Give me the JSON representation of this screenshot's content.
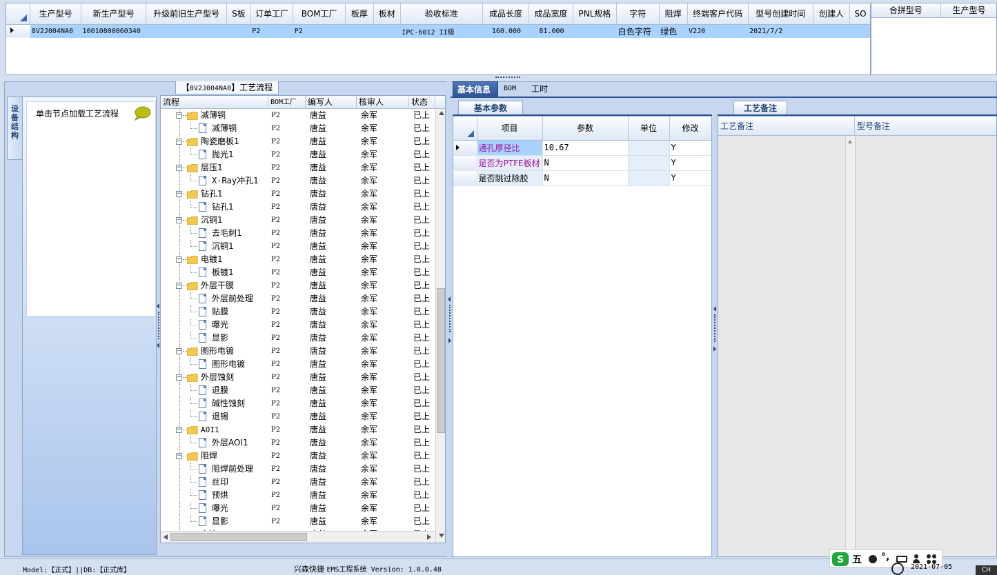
{
  "top_grid": {
    "columns": [
      "生产型号",
      "新生产型号",
      "升级前旧生产型号",
      "S板",
      "订单工厂",
      "BOM工厂",
      "板厚",
      "板材",
      "验收标准",
      "成品长度",
      "成品宽度",
      "PNL规格",
      "字符",
      "阻焊",
      "终端客户代码",
      "型号创建时间",
      "创建人",
      "SO"
    ],
    "rows": [
      [
        "8V2J004NA0",
        "10010800060340",
        "",
        "",
        "P2",
        "P2",
        "",
        "",
        "IPC-6012 II级",
        "160.000",
        "81.000",
        "",
        "白色字符",
        "绿色",
        "V2J0",
        "2021/7/2",
        "",
        ""
      ]
    ]
  },
  "merge_grid": {
    "columns": [
      "合拼型号",
      "生产型号"
    ]
  },
  "left": {
    "vertical_tab": "设备结构",
    "equip_hint": "单击节点加载工艺流程",
    "process_title_prefix": "【",
    "process_title_code": "8V2J004NA0",
    "process_title_suffix": "】工艺流程"
  },
  "tree": {
    "columns": [
      "流程",
      "BOM工厂",
      "编写人",
      "核审人",
      "状态"
    ],
    "rows": [
      {
        "level": 0,
        "label": "减薄铜",
        "bom": "P2",
        "writer": "唐益",
        "reviewer": "余军",
        "status": "已上网"
      },
      {
        "level": 1,
        "label": "减薄铜",
        "bom": "P2",
        "writer": "唐益",
        "reviewer": "余军",
        "status": "已上网"
      },
      {
        "level": 0,
        "label": "陶瓷磨板1",
        "bom": "P2",
        "writer": "唐益",
        "reviewer": "余军",
        "status": "已上网"
      },
      {
        "level": 1,
        "label": "抛光1",
        "bom": "P2",
        "writer": "唐益",
        "reviewer": "余军",
        "status": "已上网"
      },
      {
        "level": 0,
        "label": "层压1",
        "bom": "P2",
        "writer": "唐益",
        "reviewer": "余军",
        "status": "已上网"
      },
      {
        "level": 1,
        "label": "X-Ray冲孔1",
        "bom": "P2",
        "writer": "唐益",
        "reviewer": "余军",
        "status": "已上网"
      },
      {
        "level": 0,
        "label": "钻孔1",
        "bom": "P2",
        "writer": "唐益",
        "reviewer": "余军",
        "status": "已上网"
      },
      {
        "level": 1,
        "label": "钻孔1",
        "bom": "P2",
        "writer": "唐益",
        "reviewer": "余军",
        "status": "已上网"
      },
      {
        "level": 0,
        "label": "沉铜1",
        "bom": "P2",
        "writer": "唐益",
        "reviewer": "余军",
        "status": "已上网"
      },
      {
        "level": 1,
        "label": "去毛刺1",
        "bom": "P2",
        "writer": "唐益",
        "reviewer": "余军",
        "status": "已上网"
      },
      {
        "level": 1,
        "label": "沉铜1",
        "bom": "P2",
        "writer": "唐益",
        "reviewer": "余军",
        "status": "已上网"
      },
      {
        "level": 0,
        "label": "电镀1",
        "bom": "P2",
        "writer": "唐益",
        "reviewer": "余军",
        "status": "已上网"
      },
      {
        "level": 1,
        "label": "板镀1",
        "bom": "P2",
        "writer": "唐益",
        "reviewer": "余军",
        "status": "已上网"
      },
      {
        "level": 0,
        "label": "外层干膜",
        "bom": "P2",
        "writer": "唐益",
        "reviewer": "余军",
        "status": "已上网"
      },
      {
        "level": 1,
        "label": "外层前处理",
        "bom": "P2",
        "writer": "唐益",
        "reviewer": "余军",
        "status": "已上网"
      },
      {
        "level": 1,
        "label": "贴膜",
        "bom": "P2",
        "writer": "唐益",
        "reviewer": "余军",
        "status": "已上网"
      },
      {
        "level": 1,
        "label": "曝光",
        "bom": "P2",
        "writer": "唐益",
        "reviewer": "余军",
        "status": "已上网"
      },
      {
        "level": 1,
        "label": "显影",
        "bom": "P2",
        "writer": "唐益",
        "reviewer": "余军",
        "status": "已上网"
      },
      {
        "level": 0,
        "label": "图形电镀",
        "bom": "P2",
        "writer": "唐益",
        "reviewer": "余军",
        "status": "已上网"
      },
      {
        "level": 1,
        "label": "图形电镀",
        "bom": "P2",
        "writer": "唐益",
        "reviewer": "余军",
        "status": "已上网"
      },
      {
        "level": 0,
        "label": "外层蚀刻",
        "bom": "P2",
        "writer": "唐益",
        "reviewer": "余军",
        "status": "已上网"
      },
      {
        "level": 1,
        "label": "退膜",
        "bom": "P2",
        "writer": "唐益",
        "reviewer": "余军",
        "status": "已上网"
      },
      {
        "level": 1,
        "label": "碱性蚀刻",
        "bom": "P2",
        "writer": "唐益",
        "reviewer": "余军",
        "status": "已上网"
      },
      {
        "level": 1,
        "label": "退锡",
        "bom": "P2",
        "writer": "唐益",
        "reviewer": "余军",
        "status": "已上网"
      },
      {
        "level": 0,
        "label": "AOI1",
        "bom": "P2",
        "writer": "唐益",
        "reviewer": "余军",
        "status": "已上网"
      },
      {
        "level": 1,
        "label": "外层AOI1",
        "bom": "P2",
        "writer": "唐益",
        "reviewer": "余军",
        "status": "已上网"
      },
      {
        "level": 0,
        "label": "阻焊",
        "bom": "P2",
        "writer": "唐益",
        "reviewer": "余军",
        "status": "已上网"
      },
      {
        "level": 1,
        "label": "阻焊前处理",
        "bom": "P2",
        "writer": "唐益",
        "reviewer": "余军",
        "status": "已上网"
      },
      {
        "level": 1,
        "label": "丝印",
        "bom": "P2",
        "writer": "唐益",
        "reviewer": "余军",
        "status": "已上网"
      },
      {
        "level": 1,
        "label": "预烘",
        "bom": "P2",
        "writer": "唐益",
        "reviewer": "余军",
        "status": "已上网"
      },
      {
        "level": 1,
        "label": "曝光",
        "bom": "P2",
        "writer": "唐益",
        "reviewer": "余军",
        "status": "已上网"
      },
      {
        "level": 1,
        "label": "显影",
        "bom": "P2",
        "writer": "唐益",
        "reviewer": "余军",
        "status": "已上网"
      },
      {
        "level": 0,
        "label": "字符",
        "bom": "P2",
        "writer": "唐益",
        "reviewer": "余军",
        "status": "已上网"
      }
    ]
  },
  "right": {
    "tabs": [
      "基本信息",
      "BOM",
      "工时"
    ],
    "param_tab": "基本参数",
    "param_columns": [
      "项目",
      "参数",
      "单位",
      "修改"
    ],
    "param_rows": [
      {
        "item": "通孔厚径比",
        "value": "10.67",
        "unit": "",
        "modify": "Y"
      },
      {
        "item": "是否为PTFE板材",
        "value": "N",
        "unit": "",
        "modify": "Y"
      },
      {
        "item": "是否跳过除胶",
        "value": "N",
        "unit": "",
        "modify": "Y"
      }
    ],
    "remark_tab": "工艺备注",
    "remark_columns": [
      "工艺备注",
      "型号备注"
    ]
  },
  "status": {
    "model_text": "Model:【正式】||DB:【正式库】",
    "app_name": "兴森快捷",
    "app_version": "EMS工程系统  Version: 1.0.0.48",
    "ime_text": "五",
    "tray_date": "2021-07-05",
    "tray_lang": "CH"
  },
  "colors": {
    "selected_row": "#a9d3ff",
    "tab_active": "#2d5597",
    "pink_text": "#a1139f"
  }
}
